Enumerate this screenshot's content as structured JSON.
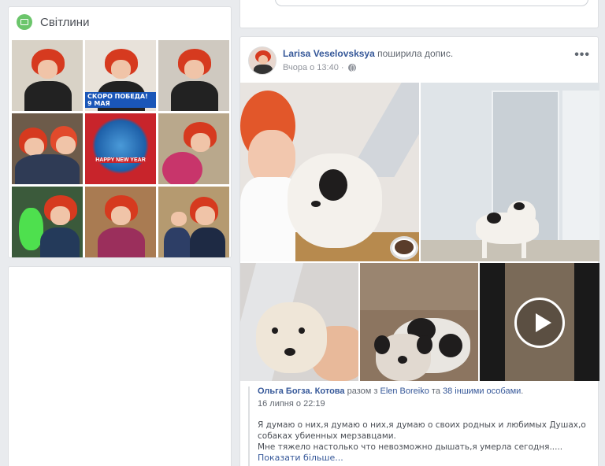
{
  "photos_widget": {
    "title": "Світлини",
    "thumbnails": [
      {
        "kind": "portrait",
        "bg": "#d8d2c6"
      },
      {
        "kind": "portrait-caption",
        "bg": "#e8e2da",
        "caption": "СКОРО ПОБЕДА! 9 МАЯ"
      },
      {
        "kind": "portrait",
        "bg": "#cfc9c0"
      },
      {
        "kind": "group",
        "bg": "#6d5b4a"
      },
      {
        "kind": "new-year",
        "bg": "#c8242b",
        "caption": "HAPPY NEW YEAR"
      },
      {
        "kind": "flowers",
        "bg": "#b9a88c"
      },
      {
        "kind": "toy",
        "bg": "#3b5a3b"
      },
      {
        "kind": "flowers",
        "bg": "#a97b52"
      },
      {
        "kind": "child",
        "bg": "#b59a70"
      }
    ]
  },
  "post": {
    "author": "Larisa Veselovsksya",
    "action": " поширила допис.",
    "timestamp": "Вчора о 13:40",
    "visibility": "globe-icon",
    "shared": {
      "author": "Ольга Богза. Котова",
      "with_text": " разом з ",
      "tagged": "Elen Boreiko",
      "and_text": " та ",
      "others": "38 іншими особами",
      "end": ".",
      "date": "16 липня о 22:19",
      "body_line1": "Я думаю о них,я думаю о них,я думаю о своих родных и любимых Душах,о собаках убиенных мерзавцами.",
      "body_line2": "Мне тяжело настолько что невозможно дышать,я умерла сегодня.....",
      "see_more": "Показати більше..."
    }
  },
  "colors": {
    "link": "#365899",
    "background": "#e9ebee",
    "photos_icon": "#6bc56b"
  }
}
